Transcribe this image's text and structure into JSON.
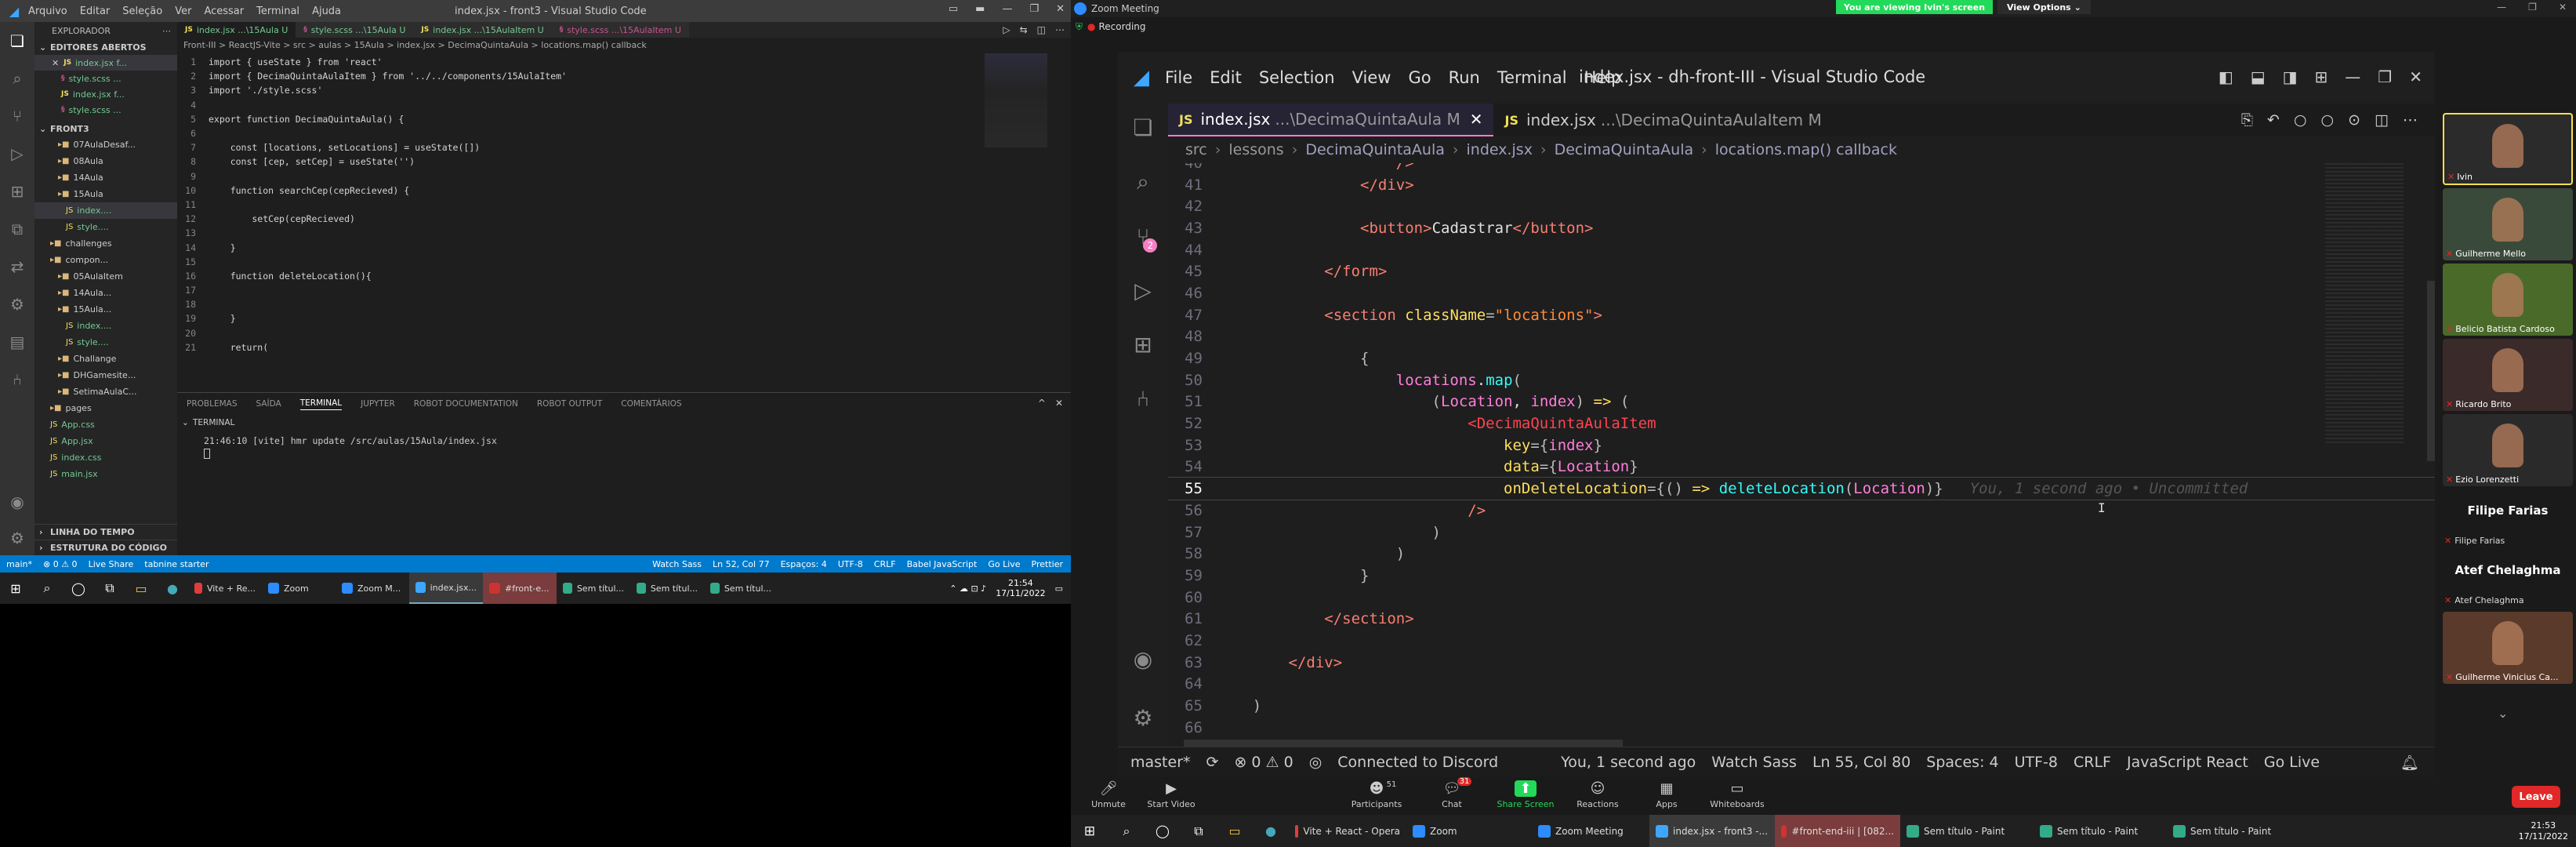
{
  "left_vscode": {
    "menu": [
      "Arquivo",
      "Editar",
      "Seleção",
      "Ver",
      "Acessar",
      "Terminal",
      "Ajuda"
    ],
    "title": "index.jsx - front3 - Visual Studio Code",
    "tabs": [
      "index.jsx ...\\15Aula U",
      "style.scss ...\\15Aula U",
      "index.jsx ...\\15AulaItem U",
      "style.scss ...\\15AulaItem U"
    ],
    "explorer_title": "EXPLORADOR",
    "open_editors": "EDITORES ABERTOS",
    "open_files": [
      "index.jsx f...",
      "style.scss ...",
      "index.jsx f...",
      "style.scss ..."
    ],
    "project": "FRONT3",
    "tree": [
      "07AulaDesaf...",
      "08Aula",
      "14Aula",
      "15Aula",
      "index....",
      "style....",
      "challenges",
      "compon...",
      "05AulaItem",
      "14Aula...",
      "15Aula...",
      "index....",
      "style....",
      "Challange",
      "DHGamesite...",
      "SetimaAulaC...",
      "pages",
      "App.css",
      "App.jsx",
      "index.css",
      "main.jsx"
    ],
    "outline": "LINHA DO TEMPO",
    "structure": "ESTRUTURA DO CÓDIGO",
    "breadcrumb": "Front-III > ReactJS-Vite > src > aulas > 15Aula > index.jsx > DecimaQuintaAula > locations.map() callback",
    "code": [
      {
        "n": "1",
        "t": "import { useState } from 'react'"
      },
      {
        "n": "2",
        "t": "import { DecimaQuintaAulaItem } from '../../components/15AulaItem'"
      },
      {
        "n": "3",
        "t": "import './style.scss'"
      },
      {
        "n": "4",
        "t": ""
      },
      {
        "n": "5",
        "t": "export function DecimaQuintaAula() {"
      },
      {
        "n": "6",
        "t": ""
      },
      {
        "n": "7",
        "t": "    const [locations, setLocations] = useState([])"
      },
      {
        "n": "8",
        "t": "    const [cep, setCep] = useState('')"
      },
      {
        "n": "9",
        "t": ""
      },
      {
        "n": "10",
        "t": "    function searchCep(cepRecieved) {"
      },
      {
        "n": "11",
        "t": ""
      },
      {
        "n": "12",
        "t": "        setCep(cepRecieved)"
      },
      {
        "n": "13",
        "t": ""
      },
      {
        "n": "14",
        "t": "    }"
      },
      {
        "n": "15",
        "t": ""
      },
      {
        "n": "16",
        "t": "    function deleteLocation(){"
      },
      {
        "n": "17",
        "t": ""
      },
      {
        "n": "18",
        "t": ""
      },
      {
        "n": "19",
        "t": "    }"
      },
      {
        "n": "20",
        "t": ""
      },
      {
        "n": "21",
        "t": "    return("
      }
    ],
    "panel_tabs": [
      "PROBLEMAS",
      "SAÍDA",
      "TERMINAL",
      "JUPYTER",
      "ROBOT DOCUMENTATION",
      "ROBOT OUTPUT",
      "COMENTÁRIOS"
    ],
    "terminal_label": "TERMINAL",
    "terminal_line": "21:46:10 [vite] hmr update /src/aulas/15Aula/index.jsx",
    "status_left": [
      "main*",
      "⊗ 0 ⚠ 0",
      "Live Share",
      "tabnine starter"
    ],
    "status_right": [
      "Watch Sass",
      "Ln 52, Col 77",
      "Espaços: 4",
      "UTF-8",
      "CRLF",
      "Babel JavaScript",
      "Go Live",
      "Prettier"
    ],
    "taskbar": [
      "Vite + Re...",
      "Zoom",
      "Zoom M...",
      "index.jsx...",
      "#front-e...",
      "Sem títul...",
      "Sem títul...",
      "Sem títul..."
    ],
    "clock": [
      "21:54",
      "17/11/2022"
    ]
  },
  "zoom": {
    "title": "Zoom Meeting",
    "viewing": "You are viewing Ivin's screen",
    "view_options": "View Options",
    "recording": "Recording",
    "controls": [
      "Unmute",
      "Start Video",
      "Participants",
      "Chat",
      "Share Screen",
      "Reactions",
      "Apps",
      "Whiteboards"
    ],
    "participants_count": "51",
    "chat_badge": "31",
    "leave": "Leave",
    "gallery": [
      "Ivin",
      "Guilherme Mello",
      "Belicio Batista Cardoso",
      "Ricardo Brito",
      "Ezio Lorenzetti",
      "Filipe Farias",
      "Filipe Farias",
      "Atef Chelaghma",
      "Atef Chelaghma",
      "Guilherme Vinicius Ca..."
    ],
    "taskbar": [
      "Vite + React - Opera",
      "Zoom",
      "Zoom Meeting",
      "index.jsx - front3 -...",
      "#front-end-iii | [082...",
      "Sem título - Paint",
      "Sem título - Paint",
      "Sem título - Paint"
    ],
    "clock": [
      "21:53",
      "17/11/2022"
    ]
  },
  "shared_vscode": {
    "menu": [
      "File",
      "Edit",
      "Selection",
      "View",
      "Go",
      "Run",
      "Terminal",
      "Help"
    ],
    "title": "index.jsx - dh-front-III - Visual Studio Code",
    "tabs": [
      "index.jsx",
      "...\\DecimaQuintaAula M",
      "index.jsx",
      "...\\DecimaQuintaAulaItem M"
    ],
    "breadcrumb": [
      "src",
      "lessons",
      "DecimaQuintaAula",
      "index.jsx",
      "DecimaQuintaAula",
      "locations.map() callback"
    ],
    "scm_badge": "2",
    "code": [
      {
        "n": "40",
        "t": "                    />"
      },
      {
        "n": "41",
        "t": "                </div>"
      },
      {
        "n": "42",
        "t": ""
      },
      {
        "n": "43",
        "t": "                <button>Cadastrar</button>"
      },
      {
        "n": "44",
        "t": ""
      },
      {
        "n": "45",
        "t": "            </form>"
      },
      {
        "n": "46",
        "t": ""
      },
      {
        "n": "47",
        "t": "            <section className=\"locations\">"
      },
      {
        "n": "48",
        "t": ""
      },
      {
        "n": "49",
        "t": "                {"
      },
      {
        "n": "50",
        "t": "                    locations.map("
      },
      {
        "n": "51",
        "t": "                        (Location, index) => ("
      },
      {
        "n": "52",
        "t": "                            <DecimaQuintaAulaItem"
      },
      {
        "n": "53",
        "t": "                                key={index}"
      },
      {
        "n": "54",
        "t": "                                data={Location}"
      },
      {
        "n": "55",
        "t": "                                onDeleteLocation={() => deleteLocation(Location)}"
      },
      {
        "n": "56",
        "t": "                            />"
      },
      {
        "n": "57",
        "t": "                        )"
      },
      {
        "n": "58",
        "t": "                    )"
      },
      {
        "n": "59",
        "t": "                }"
      },
      {
        "n": "60",
        "t": ""
      },
      {
        "n": "61",
        "t": "            </section>"
      },
      {
        "n": "62",
        "t": ""
      },
      {
        "n": "63",
        "t": "        </div>"
      },
      {
        "n": "64",
        "t": ""
      },
      {
        "n": "65",
        "t": "    )"
      },
      {
        "n": "66",
        "t": ""
      }
    ],
    "blame": "You, 1 second ago • Uncommitted",
    "status": [
      "master*",
      "⊗ 0 ⚠ 0",
      "Connected to Discord",
      "You, 1 second ago",
      "Watch Sass",
      "Ln 55, Col 80",
      "Spaces: 4",
      "UTF-8",
      "CRLF",
      "JavaScript React",
      "Go Live"
    ]
  },
  "colors": {
    "vscode_blue": "#007acc",
    "zoom_green": "#23d959",
    "leave_red": "#e02828",
    "accent_pink": "#f97ec3"
  }
}
